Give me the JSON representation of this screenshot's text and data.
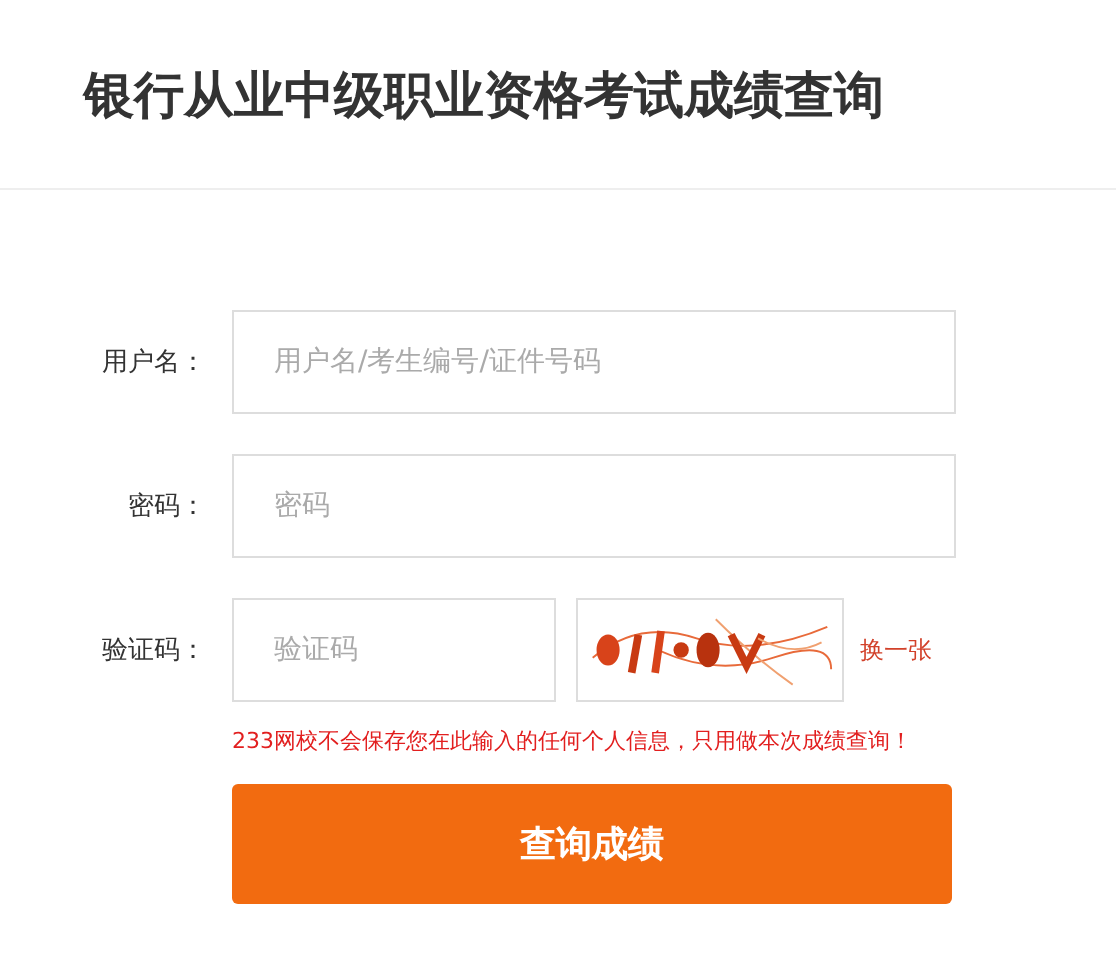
{
  "title": "银行从业中级职业资格考试成绩查询",
  "fields": [
    {
      "label": "用户名：",
      "placeholder": "用户名/考生编号/证件号码"
    },
    {
      "label": "密码：",
      "placeholder": "密码"
    }
  ],
  "captcha": {
    "label": "验证码：",
    "placeholder": "验证码",
    "refresh": "换一张"
  },
  "notice": "233网校不会保存您在此输入的任何个人信息，只用做本次成绩查询！",
  "submit": "查询成绩"
}
